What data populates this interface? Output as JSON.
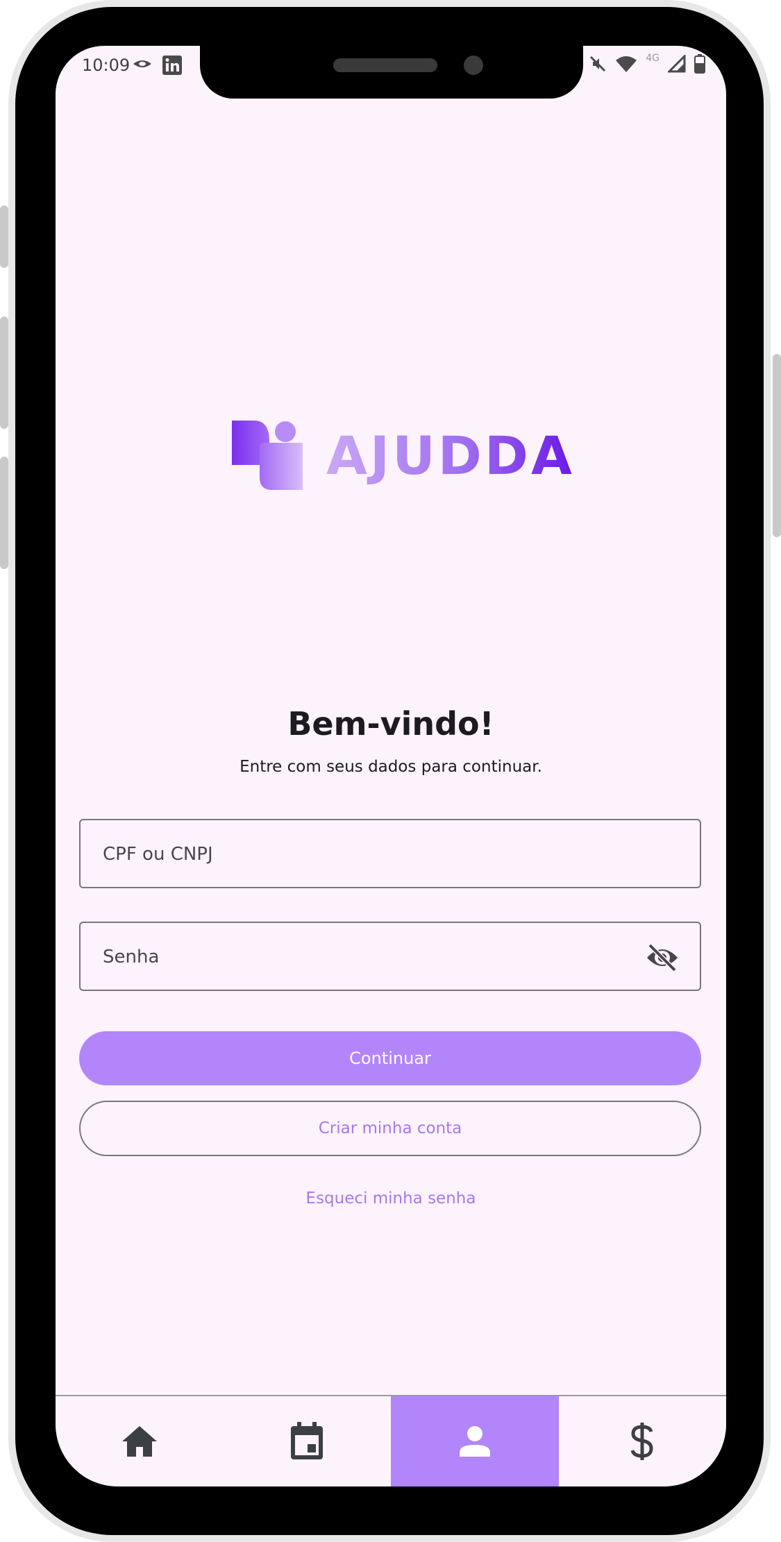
{
  "status_bar": {
    "time": "10:09",
    "network_label": "4G",
    "left_icons": [
      "eye-notification-icon",
      "linkedin-icon"
    ],
    "right_icons": [
      "mute-icon",
      "wifi-icon",
      "signal-icon",
      "battery-icon"
    ]
  },
  "brand": {
    "name": "AJUDDA",
    "logo_icon": "ajudda-logo-icon",
    "gradient_colors": [
      "#c9a8f6",
      "#9f6ff0",
      "#6a17e6"
    ]
  },
  "login": {
    "title": "Bem-vindo!",
    "subtitle": "Entre com seus dados para continuar.",
    "document_placeholder": "CPF ou CNPJ",
    "document_value": "",
    "password_placeholder": "Senha",
    "password_value": "",
    "password_toggle_icon": "eye-off-icon",
    "continue_label": "Continuar",
    "create_account_label": "Criar minha conta",
    "forgot_password_label": "Esqueci minha senha"
  },
  "bottom_nav": {
    "items": [
      {
        "icon": "home-icon",
        "active": false
      },
      {
        "icon": "calendar-icon",
        "active": false
      },
      {
        "icon": "person-icon",
        "active": true
      },
      {
        "icon": "dollar-icon",
        "active": false
      }
    ]
  },
  "colors": {
    "accent": "#b285fb",
    "link": "#a877ec",
    "screen_background": "#fcf3fd",
    "text": "#1d1b20"
  }
}
